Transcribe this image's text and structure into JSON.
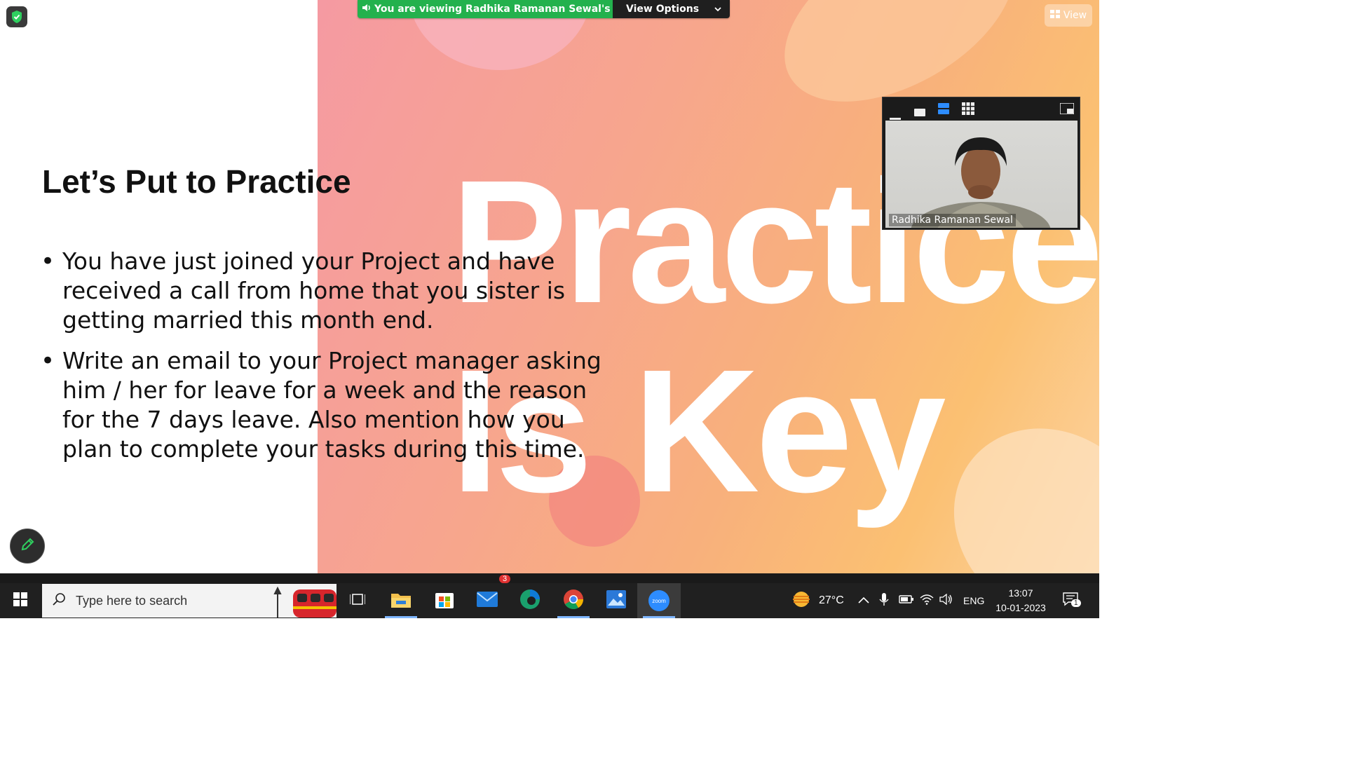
{
  "share_banner": {
    "viewing_text": "You are viewing Radhika Ramanan Sewal's screen",
    "view_options_label": "View Options"
  },
  "top_right": {
    "view_label": "View"
  },
  "slide": {
    "title": "Let’s Put to Practice",
    "background_words": [
      "Practice",
      "Is Key"
    ],
    "bullets": [
      "You have just joined your Project and have received a call from home that you sister is getting married this month end.",
      "Write an email to your Project manager asking him / her for leave for a week and the reason for the 7 days leave. Also mention how you plan to complete your tasks during this time."
    ]
  },
  "video_panel": {
    "participant_name": "Radhika Ramanan Sewal"
  },
  "taskbar": {
    "search_placeholder": "Type here to search",
    "apps": [
      "task-view",
      "file-explorer",
      "microsoft-store",
      "mail",
      "edge",
      "chrome",
      "photos",
      "zoom"
    ],
    "zoom_label": "zoom",
    "chat_badge": "3",
    "weather": "27°C",
    "language": "ENG",
    "time": "13:07",
    "date": "10-01-2023",
    "notification_count": "1"
  },
  "colors": {
    "banner_green": "#23b14d",
    "taskbar_bg": "#202020",
    "slide_gradient_start": "#f59aa2",
    "slide_gradient_end": "#fcd3a0"
  }
}
